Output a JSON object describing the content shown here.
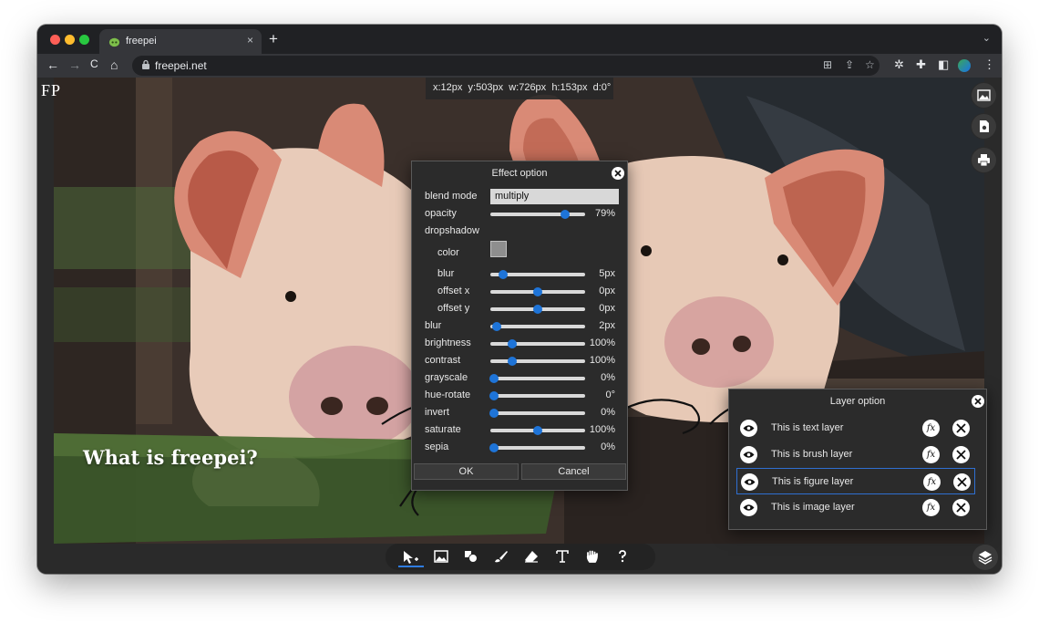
{
  "browser": {
    "tab_title": "freepei",
    "tab_close": "×",
    "new_tab": "+",
    "url": "freepei.net",
    "back": "←",
    "forward": "→",
    "reload": "C",
    "home": "⌂"
  },
  "app": {
    "logo": "FP",
    "status": {
      "x": "x:12px",
      "y": "y:503px",
      "w": "w:726px",
      "h": "h:153px",
      "d": "d:0°"
    },
    "overlay_title": "What is freepei?"
  },
  "effect_option": {
    "title": "Effect option",
    "blend_mode": {
      "label": "blend mode",
      "value": "multiply"
    },
    "opacity": {
      "label": "opacity",
      "value": "79%",
      "level": 0.79
    },
    "dropshadow": {
      "label": "dropshadow",
      "color_label": "color",
      "color": "#8e8e8e",
      "blur": {
        "label": "blur",
        "value": "5px",
        "level": 0.13
      },
      "offset_x": {
        "label": "offset x",
        "value": "0px",
        "level": 0.5
      },
      "offset_y": {
        "label": "offset y",
        "value": "0px",
        "level": 0.5
      }
    },
    "blur": {
      "label": "blur",
      "value": "2px",
      "level": 0.07
    },
    "brightness": {
      "label": "brightness",
      "value": "100%",
      "level": 0.23
    },
    "contrast": {
      "label": "contrast",
      "value": "100%",
      "level": 0.23
    },
    "grayscale": {
      "label": "grayscale",
      "value": "0%",
      "level": 0.04
    },
    "hue_rotate": {
      "label": "hue-rotate",
      "value": "0°",
      "level": 0.04
    },
    "invert": {
      "label": "invert",
      "value": "0%",
      "level": 0.04
    },
    "saturate": {
      "label": "saturate",
      "value": "100%",
      "level": 0.5
    },
    "sepia": {
      "label": "sepia",
      "value": "0%",
      "level": 0.04
    },
    "ok": "OK",
    "cancel": "Cancel"
  },
  "layer_option": {
    "title": "Layer option",
    "layers": [
      {
        "label": "This is text layer",
        "active": false
      },
      {
        "label": "This is brush layer",
        "active": false
      },
      {
        "label": "This is figure layer",
        "active": true
      },
      {
        "label": "This is image layer",
        "active": false
      }
    ],
    "fx": "fx"
  },
  "colors": {
    "accent": "#1e74d8",
    "dialog_bg": "#2b2b2b",
    "active_border": "#2f6fd1"
  }
}
